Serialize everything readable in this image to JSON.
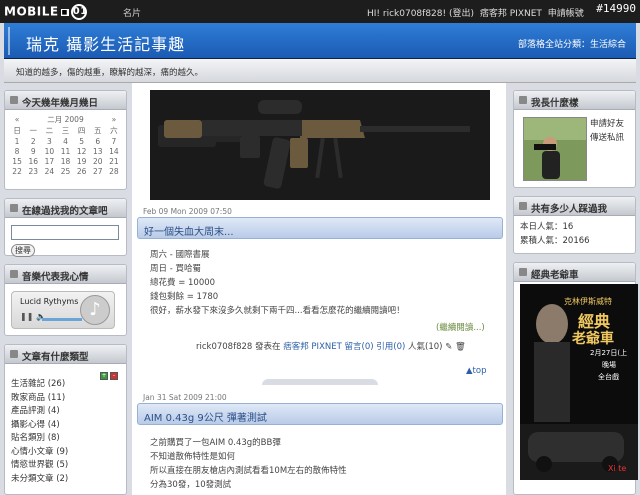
{
  "topbar": {
    "logo_a": "MOBILE",
    "logo_mid": "01",
    "mingpian": "名片",
    "greeting": "HI! rick0708f828! (登出)",
    "visitor_pixnet": "痞客邦 PIXNET",
    "apply_blog": "申請帳號",
    "count_badge": "#14990"
  },
  "header": {
    "title": "瑞克  攝影生活記事趣",
    "links": "部落格全站分類：生活綜合"
  },
  "subtitle": "知道的越多，傷的越重，瞭解的越深，痛的越久。",
  "calendar": {
    "title": "今天幾年幾月幾日",
    "prev": "«",
    "month": "二月 2009",
    "next": "»",
    "weekdays": [
      "日",
      "一",
      "二",
      "三",
      "四",
      "五",
      "六"
    ],
    "rows": [
      [
        "1",
        "2",
        "3",
        "4",
        "5",
        "6",
        "7"
      ],
      [
        "8",
        "9",
        "10",
        "11",
        "12",
        "13",
        "14"
      ],
      [
        "15",
        "16",
        "17",
        "18",
        "19",
        "20",
        "21"
      ],
      [
        "22",
        "23",
        "24",
        "25",
        "26",
        "27",
        "28"
      ]
    ]
  },
  "search": {
    "title": "在線過找我的文章吧",
    "button": "搜尋"
  },
  "music": {
    "title": "音樂代表我心情",
    "player_label": "Lucid Rythyms",
    "note_icon": "music-note-icon"
  },
  "categories": {
    "title": "文章有什麼類型",
    "items": [
      "生活雜記 (26)",
      "敗家商品 (11)",
      "產品評測 (4)",
      "攝影心得 (4)",
      "貼名類別 (8)",
      "心情小文章 (9)",
      "情慾世界觀 (5)",
      "未分類文章 (2)"
    ]
  },
  "posts": [
    {
      "date": "Feb 09 Mon 2009 07:50",
      "title": "好一個失血大周末...",
      "lines": [
        "周六 - 國際書展",
        "周日 - 買哈蜀",
        "總花費 = 10000",
        "錢包剩餘 = 1780",
        "很好，薪水發下來沒多久就剩下兩千四...看看怎麼花的繼續閱讀吧！"
      ],
      "read_more": "(繼續閱讀...)",
      "meta_author": "rick0708f828",
      "meta_published": "發表在",
      "meta_pixnet": "痞客邦 PIXNET",
      "meta_comment": "留言(0)",
      "meta_quote": "引用(0)",
      "meta_views": "人氣(10)",
      "top": "▲top"
    },
    {
      "date": "Jan 31 Sat 2009 21:00",
      "title": "AIM 0.43g 9公尺 彈著測試",
      "lines": [
        "之前購買了一包AIM 0.43g的BB彈",
        "不知道散佈特性是如何",
        "所以直接在朋友槍店內測試看看10M左右的散佈特性",
        "分為30發，10發測試"
      ]
    }
  ],
  "profile": {
    "title": "我長什麼樣",
    "line1": "申請好友",
    "line2": "傳送私訊"
  },
  "visitors": {
    "title": "共有多少人踩過我",
    "today": "本日人氣：16",
    "total": "累積人氣：20166"
  },
  "poster": {
    "title": "經典老爺車",
    "actor": "克林伊斯威特",
    "film_a": "經典",
    "film_b": "老爺車",
    "release": "2月27日(上",
    "line2": "晚場",
    "line3": "全台戲",
    "brand": "Xi te"
  },
  "colors": {
    "header_blue": "#2f7ed6",
    "link_blue": "#2b5fa6",
    "post_title": "#2a4f86"
  }
}
